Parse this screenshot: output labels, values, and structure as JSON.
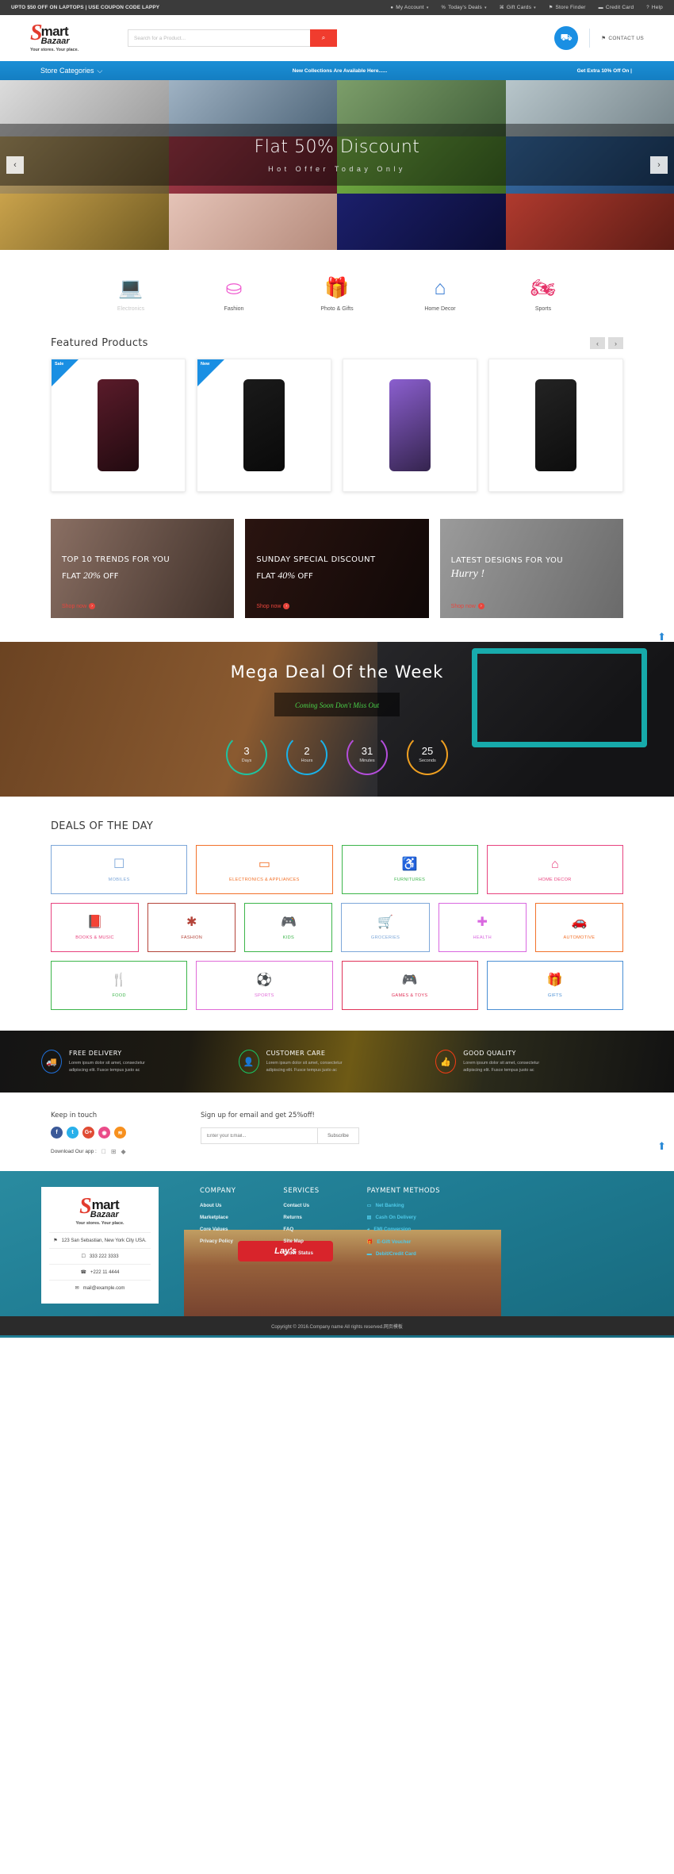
{
  "topbar": {
    "promo": "UPTO $50 OFF ON LAPTOPS | USE COUPON CODE LAPPY",
    "links": [
      {
        "icon": "user-icon",
        "glyph": "●",
        "label": "My Account",
        "caret": "▾"
      },
      {
        "icon": "percent-icon",
        "glyph": "%",
        "label": "Today's Deals",
        "caret": "▾"
      },
      {
        "icon": "gift-icon",
        "glyph": "⌘",
        "label": "Gift Cards",
        "caret": "▾"
      },
      {
        "icon": "location-pin-icon",
        "glyph": "⚑",
        "label": "Store Finder",
        "caret": ""
      },
      {
        "icon": "credit-card-icon",
        "glyph": "▬",
        "label": "Credit Card",
        "caret": ""
      },
      {
        "icon": "help-circle-icon",
        "glyph": "?",
        "label": "Help",
        "caret": ""
      }
    ]
  },
  "logo": {
    "s": "S",
    "mart": "mart",
    "bazaar": "Bazaar",
    "tagline": "Your stores. Your place."
  },
  "search": {
    "placeholder": "Search for a Product...",
    "value": "",
    "icon": "search-icon",
    "glyph": "⌕"
  },
  "header": {
    "cart_icon": "shopping-cart-icon",
    "cart_glyph": "⛟",
    "contact": "CONTACT US",
    "contact_icon": "location-pin-icon",
    "contact_glyph": "⚑"
  },
  "nav": {
    "categories": "Store Categories",
    "caret": "⌵",
    "middle": "New Collections Are Available Here......",
    "right": "Get Extra 10% Off On |"
  },
  "hero": {
    "title": "Flat 50% Discount",
    "subtitle": "Hot Offer Today Only",
    "prev": "‹",
    "next": "›",
    "tiles": [
      {
        "name": "mannequins",
        "c1": "#9a8f82",
        "c2": "#6b5f52"
      },
      {
        "name": "handbags",
        "c1": "#cf8a5a",
        "c2": "#7d4b30"
      },
      {
        "name": "straw-hat",
        "c1": "#b8a383",
        "c2": "#6e5c44"
      },
      {
        "name": "grocery-aisle",
        "c1": "#6e8f5c",
        "c2": "#3d5a33"
      },
      {
        "name": "coca-cola",
        "c1": "#b03a2e",
        "c2": "#5d1c15"
      },
      {
        "name": "jewelry-necklace",
        "c1": "#1b1f6b",
        "c2": "#0b0d35"
      },
      {
        "name": "pink-crib",
        "c1": "#e5c3b7",
        "c2": "#b58b7c"
      },
      {
        "name": "supermarket",
        "c1": "#c9a24b",
        "c2": "#6f5a22"
      },
      {
        "name": "toys",
        "c1": "#3a6fa8",
        "c2": "#1c3c63"
      },
      {
        "name": "makeup-palette",
        "c1": "#7ab648",
        "c2": "#3e6b23"
      },
      {
        "name": "lipstick",
        "c1": "#a83b4a",
        "c2": "#5c1e28"
      },
      {
        "name": "wrist-watch",
        "c1": "#b9a06a",
        "c2": "#6b5731"
      },
      {
        "name": "bicycle",
        "c1": "#b8c6cb",
        "c2": "#76858b"
      },
      {
        "name": "flowers",
        "c1": "#7c9e6a",
        "c2": "#42603a"
      },
      {
        "name": "smartphone-hand",
        "c1": "#9fb2c3",
        "c2": "#4d6478"
      },
      {
        "name": "pens",
        "c1": "#dcdcdc",
        "c2": "#9a9a9a"
      }
    ]
  },
  "categories": [
    {
      "name": "electronics",
      "label": "Electronics",
      "icon": "laptop-icon",
      "glyph": "💻",
      "color": "#d8d8d8",
      "muted": true
    },
    {
      "name": "fashion",
      "label": "Fashion",
      "icon": "woman-icon",
      "glyph": "⛀",
      "color": "#ef5bd0"
    },
    {
      "name": "photo-gifts",
      "label": "Photo & Gifts",
      "icon": "gift-icon",
      "glyph": "🎁",
      "color": "#f76b1c"
    },
    {
      "name": "home-decor",
      "label": "Home Decor",
      "icon": "house-icon",
      "glyph": "⌂",
      "color": "#3e7fd4"
    },
    {
      "name": "sports",
      "label": "Sports",
      "icon": "motorbike-icon",
      "glyph": "🏍",
      "color": "#e6336a"
    }
  ],
  "featured": {
    "title": "Featured Products",
    "prev": "‹",
    "next": "›",
    "products": [
      {
        "name": "refrigerator",
        "badge": "Sale",
        "icon": "refrigerator-icon",
        "color": "#5a1b2a"
      },
      {
        "name": "smartphone",
        "badge": "New",
        "icon": "smartphone-icon",
        "color": "#1a1a1a"
      },
      {
        "name": "digital-camera",
        "badge": "",
        "icon": "camera-icon",
        "color": "#8b5fcf"
      },
      {
        "name": "speaker-system",
        "badge": "",
        "icon": "speaker-icon",
        "color": "#232323"
      }
    ]
  },
  "promos": [
    {
      "name": "top-trends",
      "line1": "TOP 10 TRENDS FOR YOU",
      "line2_pre": "FLAT ",
      "line2_pct": "20%",
      "line2_post": " OFF",
      "script": "",
      "cta": "Shop now",
      "c1": "#8a6f63",
      "c2": "#3f3029"
    },
    {
      "name": "sunday-special",
      "line1": "SUNDAY SPECIAL DISCOUNT",
      "line2_pre": "FLAT ",
      "line2_pct": "40%",
      "line2_post": " OFF",
      "script": "",
      "cta": "Shop now",
      "c1": "#2a1410",
      "c2": "#100807"
    },
    {
      "name": "latest-designs",
      "line1": "LATEST DESIGNS FOR YOU",
      "line2_pre": "",
      "line2_pct": "",
      "line2_post": "",
      "script": "Hurry !",
      "cta": "Shop now",
      "c1": "#9b9b9b",
      "c2": "#6a6a6a"
    }
  ],
  "mega": {
    "title": "Mega Deal Of the Week",
    "subtitle": "Coming Soon Don't Miss Out",
    "counters": [
      {
        "name": "days",
        "value": "3",
        "label": "Days",
        "color": "#1fc2a0"
      },
      {
        "name": "hours",
        "value": "2",
        "label": "Hours",
        "color": "#1ab2e8"
      },
      {
        "name": "minutes",
        "value": "31",
        "label": "Minutes",
        "color": "#b44ddb"
      },
      {
        "name": "seconds",
        "value": "25",
        "label": "Seconds",
        "color": "#f0a020"
      }
    ]
  },
  "deals": {
    "title": "DEALS OF THE DAY",
    "row1": [
      {
        "name": "mobiles",
        "label": "MOBILES",
        "icon": "mobile-icon",
        "glyph": "☐",
        "color": "#7da7d9"
      },
      {
        "name": "electronics-appliances",
        "label": "ELECTRONICS & APPLIANCES",
        "icon": "laptop-icon",
        "glyph": "▭",
        "color": "#f2722b"
      },
      {
        "name": "furnitures",
        "label": "FURNITURES",
        "icon": "wheelchair-icon",
        "glyph": "♿",
        "color": "#3cb54a"
      },
      {
        "name": "home-decor",
        "label": "HOME DECOR",
        "icon": "house-icon",
        "glyph": "⌂",
        "color": "#e8437f"
      }
    ],
    "row2": [
      {
        "name": "books-music",
        "label": "BOOKS & MUSIC",
        "icon": "book-icon",
        "glyph": "📕",
        "color": "#e8437f"
      },
      {
        "name": "fashion",
        "label": "FASHION",
        "icon": "asterisk-icon",
        "glyph": "✱",
        "color": "#b4443a"
      },
      {
        "name": "kids",
        "label": "KIDS",
        "icon": "gamepad-icon",
        "glyph": "🎮",
        "color": "#3cb54a"
      },
      {
        "name": "groceries",
        "label": "GROCERIES",
        "icon": "basket-icon",
        "glyph": "🛒",
        "color": "#7da7d9"
      },
      {
        "name": "health",
        "label": "HEALTH",
        "icon": "medkit-icon",
        "glyph": "✚",
        "color": "#d968e0"
      },
      {
        "name": "automotive",
        "label": "AUTOMOTIVE",
        "icon": "car-icon",
        "glyph": "🚗",
        "color": "#f2722b"
      }
    ],
    "row3": [
      {
        "name": "food",
        "label": "FOOD",
        "icon": "cutlery-icon",
        "glyph": "🍴",
        "color": "#3cb54a"
      },
      {
        "name": "sports",
        "label": "SPORTS",
        "icon": "soccer-ball-icon",
        "glyph": "⚽",
        "color": "#e06ad8"
      },
      {
        "name": "games-toys",
        "label": "GAMES & TOYS",
        "icon": "gamepad-icon",
        "glyph": "🎮",
        "color": "#e03359"
      },
      {
        "name": "gifts",
        "label": "GIFTS",
        "icon": "gift-icon",
        "glyph": "🎁",
        "color": "#4a8fd4"
      }
    ]
  },
  "services": [
    {
      "name": "free-delivery",
      "title": "FREE DELIVERY",
      "text": "Lorem ipsum dolor sit amet, consectetur adipiscing elit. Fusce tempus justo ac",
      "icon": "truck-icon",
      "glyph": "🚚",
      "color": "#1f6fd8"
    },
    {
      "name": "customer-care",
      "title": "CUSTOMER CARE",
      "text": "Lorem ipsum dolor sit amet, consectetur adipiscing elit. Fusce tempus justo ac",
      "icon": "user-icon",
      "glyph": "👤",
      "color": "#18c463"
    },
    {
      "name": "good-quality",
      "title": "GOOD QUALITY",
      "text": "Lorem ipsum dolor sit amet, consectetur adipiscing elit. Fusce tempus justo ac",
      "icon": "thumbs-up-icon",
      "glyph": "👍",
      "color": "#f23c15"
    }
  ],
  "keep": {
    "title": "Keep in touch",
    "socials": [
      {
        "name": "facebook",
        "glyph": "f",
        "color": "#3b5998"
      },
      {
        "name": "twitter",
        "glyph": "t",
        "color": "#29b0ea"
      },
      {
        "name": "google-plus",
        "glyph": "G+",
        "color": "#e04b34"
      },
      {
        "name": "dribbble",
        "glyph": "◉",
        "color": "#ea4c89"
      },
      {
        "name": "rss",
        "glyph": "≋",
        "color": "#f7901e"
      }
    ],
    "download_label": "Download Our app :",
    "stores": [
      {
        "name": "apple-store",
        "glyph": ""
      },
      {
        "name": "windows-store",
        "glyph": "⊞"
      },
      {
        "name": "android-store",
        "glyph": "◆"
      }
    ]
  },
  "signup": {
    "title": "Sign up for email and get 25%off!",
    "placeholder": "Enter your Email...",
    "value": "",
    "button": "Subscribe"
  },
  "footer": {
    "address": "123 San Sebastian, New York City USA.",
    "address_icon": "location-pin-icon",
    "address_glyph": "⚑",
    "mobile": "333 222 3333",
    "mobile_icon": "mobile-icon",
    "mobile_glyph": "☐",
    "phone": "+222 11 4444",
    "phone_icon": "phone-icon",
    "phone_glyph": "☎",
    "email": "mail@example.com",
    "email_icon": "envelope-icon",
    "email_glyph": "✉",
    "columns": [
      {
        "name": "company",
        "heading": "COMPANY",
        "links": [
          "About Us",
          "Marketplace",
          "Core Values",
          "Privacy Policy"
        ]
      },
      {
        "name": "services",
        "heading": "SERVICES",
        "links": [
          "Contact Us",
          "Returns",
          "FAQ",
          "Site Map",
          "Order Status"
        ]
      }
    ],
    "payment": {
      "heading": "PAYMENT METHODS",
      "items": [
        {
          "name": "net-banking",
          "label": "Net Banking",
          "icon": "monitor-icon",
          "glyph": "▭"
        },
        {
          "name": "cash-on-delivery",
          "label": "Cash On Delivery",
          "icon": "money-icon",
          "glyph": "▤"
        },
        {
          "name": "emi-conversion",
          "label": "EMI Conversion",
          "icon": "pie-chart-icon",
          "glyph": "◕"
        },
        {
          "name": "e-gift-voucher",
          "label": "E-Gift Voucher",
          "icon": "gift-icon",
          "glyph": "🎁"
        },
        {
          "name": "debit-credit-card",
          "label": "Debit/Credit Card",
          "icon": "credit-card-icon",
          "glyph": "▬"
        }
      ]
    },
    "copyright": "Copyright © 2016.Company name All rights reserved.网页模板"
  },
  "scroll_top": {
    "name": "scroll-to-top-icon",
    "glyph": "⬆"
  },
  "colors": {
    "accent_red": "#f03c2e",
    "accent_blue": "#1a8fe3",
    "nav_blue": "#147ec2",
    "footer_teal": "#1f7c93",
    "topbar_dark": "#3b3b3b"
  }
}
